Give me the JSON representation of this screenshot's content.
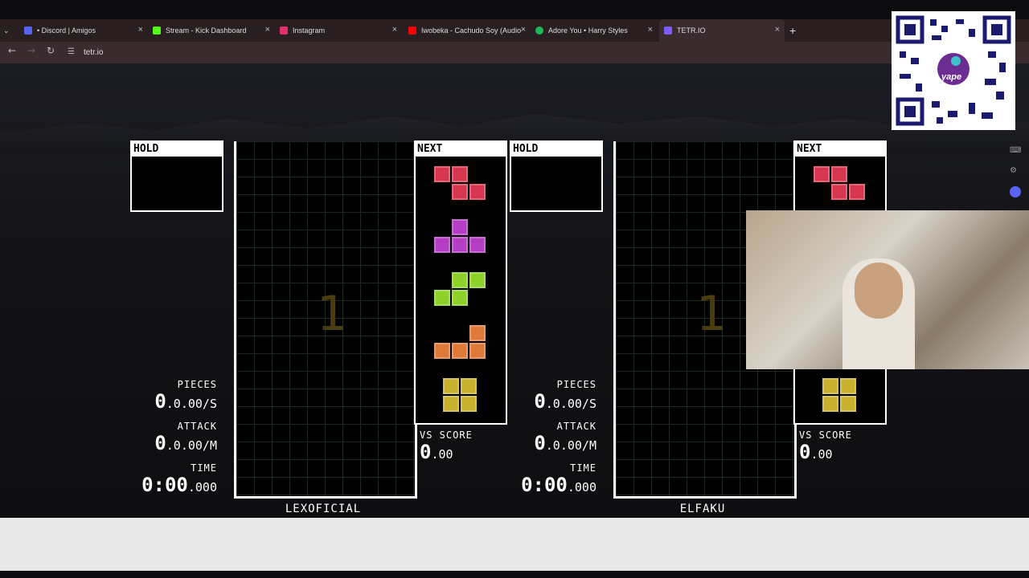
{
  "tabs": [
    {
      "label": "• Discord | Amigos",
      "icon": "discord-icon",
      "color": "#5865f2"
    },
    {
      "label": "Stream - Kick Dashboard",
      "icon": "kick-icon",
      "color": "#53fc18"
    },
    {
      "label": "Instagram",
      "icon": "instagram-icon",
      "color": "#e1306c"
    },
    {
      "label": "Iwobeka - Cachudo Soy (Audio",
      "icon": "youtube-icon",
      "color": "#ff0000"
    },
    {
      "label": "Adore You • Harry Styles",
      "icon": "spotify-icon",
      "color": "#1db954"
    },
    {
      "label": "TETR.IO",
      "icon": "tetrio-icon",
      "color": "#7b5cff"
    }
  ],
  "address": {
    "url": "tetr.io"
  },
  "players": [
    {
      "name": "LEXOFICIAL",
      "hold_label": "HOLD",
      "next_label": "NEXT",
      "pieces_label": "PIECES",
      "pieces": "0",
      "pieces_rate": ".0.00/S",
      "attack_label": "ATTACK",
      "attack": "0",
      "attack_rate": ".0.00/M",
      "time_label": "TIME",
      "time_main": "0:00",
      "time_ms": ".000",
      "vs_label": "VS SCORE",
      "vs_main": "0",
      "vs_dec": ".00",
      "countdown": "1"
    },
    {
      "name": "ELFAKU",
      "hold_label": "HOLD",
      "next_label": "NEXT",
      "pieces_label": "PIECES",
      "pieces": "0",
      "pieces_rate": ".0.00/S",
      "attack_label": "ATTACK",
      "attack": "0",
      "attack_rate": ".0.00/M",
      "time_label": "TIME",
      "time_main": "0:00",
      "time_ms": ".000",
      "vs_label": "VS SCORE",
      "vs_main": "0",
      "vs_dec": ".00",
      "countdown": "1"
    }
  ],
  "next_queue": [
    "Z",
    "T",
    "S",
    "L",
    "O"
  ],
  "colors": {
    "Z": "#d8354f",
    "T": "#b43ec4",
    "S": "#8dd12a",
    "L": "#e07a3a",
    "O": "#c9b12e"
  },
  "overlay": {
    "qr_brand": "yape"
  }
}
